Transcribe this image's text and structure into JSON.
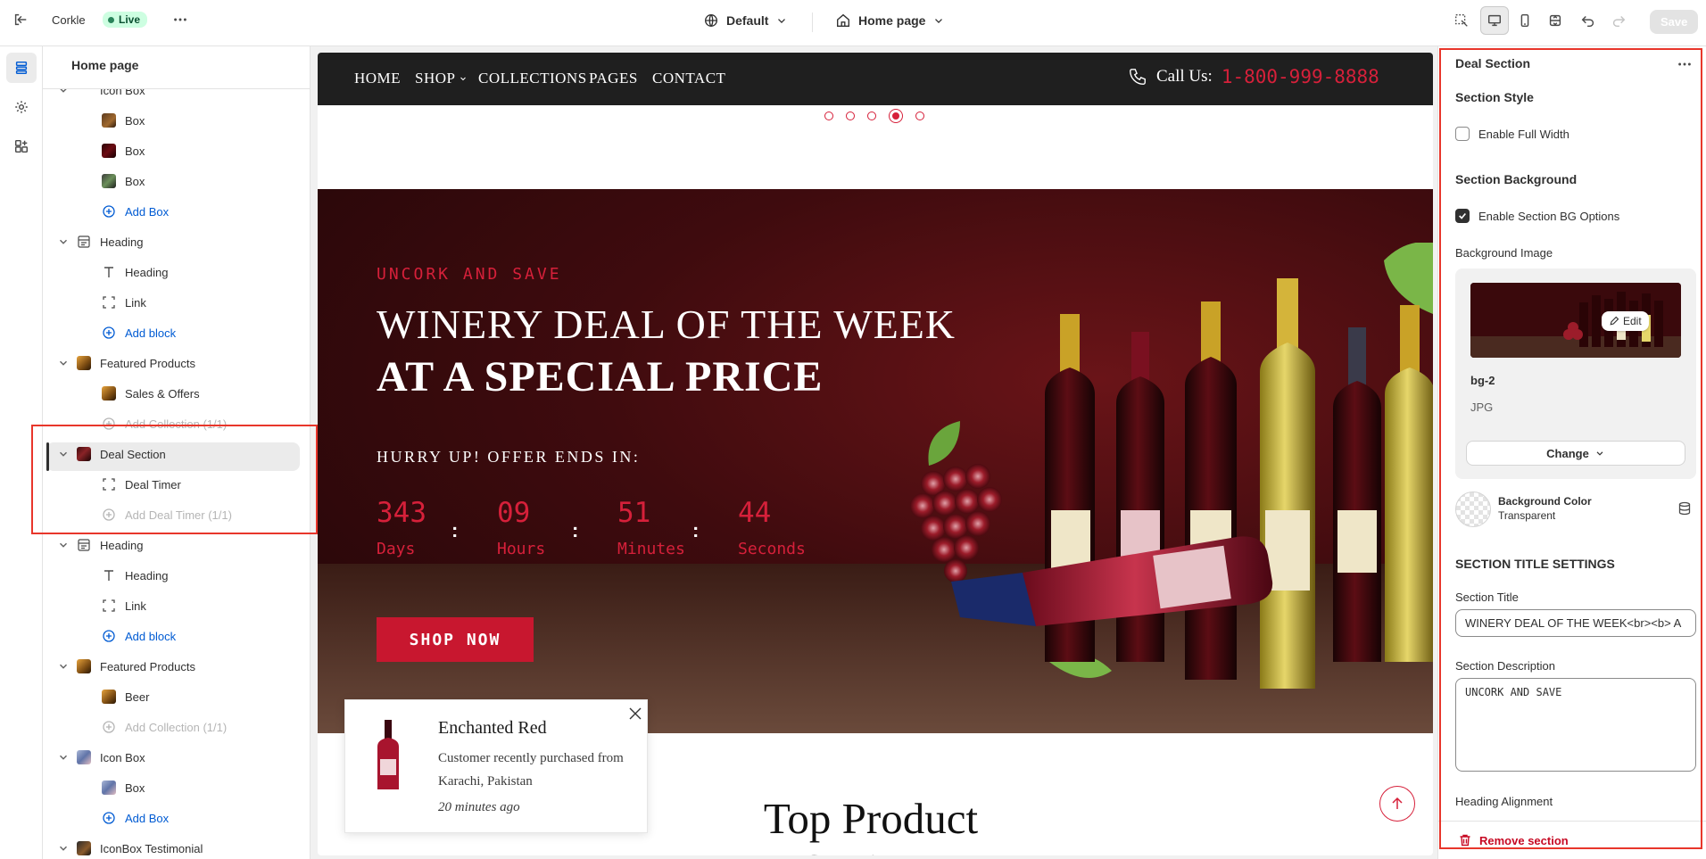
{
  "topbar": {
    "store_name": "Corkle",
    "live_label": "Live",
    "theme_selector": "Default",
    "page_selector": "Home page",
    "save_label": "Save"
  },
  "left_panel": {
    "title": "Home page",
    "items": [
      {
        "label": "Icon Box",
        "type": "section-partial"
      },
      {
        "label": "Box",
        "type": "block",
        "thumb": "a"
      },
      {
        "label": "Box",
        "type": "block",
        "thumb": "b"
      },
      {
        "label": "Box",
        "type": "block",
        "thumb": "c"
      },
      {
        "label": "Add Box",
        "type": "add"
      },
      {
        "label": "Heading",
        "type": "section",
        "icon": "heading-icon"
      },
      {
        "label": "Heading",
        "type": "block",
        "icon": "text-icon"
      },
      {
        "label": "Link",
        "type": "block",
        "icon": "link-block-icon"
      },
      {
        "label": "Add block",
        "type": "add"
      },
      {
        "label": "Featured Products",
        "type": "section",
        "thumb": "d"
      },
      {
        "label": "Sales & Offers",
        "type": "block",
        "thumb": "d"
      },
      {
        "label": "Add Collection (1/1)",
        "type": "add-disabled"
      },
      {
        "label": "Deal Section",
        "type": "section-selected",
        "thumb": "e"
      },
      {
        "label": "Deal Timer",
        "type": "block",
        "icon": "link-block-icon"
      },
      {
        "label": "Add Deal Timer (1/1)",
        "type": "add-disabled"
      },
      {
        "label": "Heading",
        "type": "section",
        "icon": "heading-icon"
      },
      {
        "label": "Heading",
        "type": "block",
        "icon": "text-icon"
      },
      {
        "label": "Link",
        "type": "block",
        "icon": "link-block-icon"
      },
      {
        "label": "Add block",
        "type": "add"
      },
      {
        "label": "Featured Products",
        "type": "section",
        "thumb": "d"
      },
      {
        "label": "Beer",
        "type": "block",
        "thumb": "d"
      },
      {
        "label": "Add Collection (1/1)",
        "type": "add-disabled"
      },
      {
        "label": "Icon Box",
        "type": "section",
        "thumb": "f"
      },
      {
        "label": "Box",
        "type": "block",
        "thumb": "f"
      },
      {
        "label": "Add Box",
        "type": "add"
      },
      {
        "label": "IconBox Testimonial",
        "type": "section",
        "thumb": "g"
      }
    ]
  },
  "preview": {
    "nav": {
      "items": [
        "HOME",
        "SHOP",
        "COLLECTIONS",
        "PAGES",
        "CONTACT"
      ],
      "call_label": "Call Us:",
      "phone": "1-800-999-8888"
    },
    "deal": {
      "subtitle": "UNCORK AND SAVE",
      "title_line1": "WINERY DEAL OF THE WEEK",
      "title_line2": "AT A SPECIAL PRICE",
      "hurry": "HURRY UP! OFFER ENDS IN:",
      "timer": [
        {
          "value": "343",
          "label": "Days"
        },
        {
          "value": "09",
          "label": "Hours"
        },
        {
          "value": "51",
          "label": "Minutes"
        },
        {
          "value": "44",
          "label": "Seconds"
        }
      ],
      "shop_button": "SHOP NOW"
    },
    "toast": {
      "title": "Enchanted Red",
      "description": "Customer recently purchased from Karachi, Pakistan",
      "time": "20 minutes ago"
    },
    "next_heading": "Top Product Savings"
  },
  "right_panel": {
    "title": "Deal Section",
    "section_style_heading": "Section Style",
    "full_width_label": "Enable Full Width",
    "full_width_checked": false,
    "section_bg_heading": "Section Background",
    "bg_options_label": "Enable Section BG Options",
    "bg_options_checked": true,
    "bg_image_label": "Background Image",
    "bg_image": {
      "filename": "bg-2",
      "type": "JPG",
      "edit_label": "Edit",
      "change_label": "Change"
    },
    "bg_color_label": "Background Color",
    "bg_color_value": "Transparent",
    "title_settings_heading": "SECTION TITLE SETTINGS",
    "section_title_label": "Section Title",
    "section_title_value": "WINERY DEAL OF THE WEEK<br><b> A",
    "section_desc_label": "Section Description",
    "section_desc_value": "UNCORK AND SAVE",
    "heading_alignment_label": "Heading Alignment",
    "remove_label": "Remove section"
  },
  "colors": {
    "accent_red": "#d6203a",
    "annotation_red": "#e8362b",
    "link_blue": "#005bd3",
    "live_green": "#29845a"
  }
}
